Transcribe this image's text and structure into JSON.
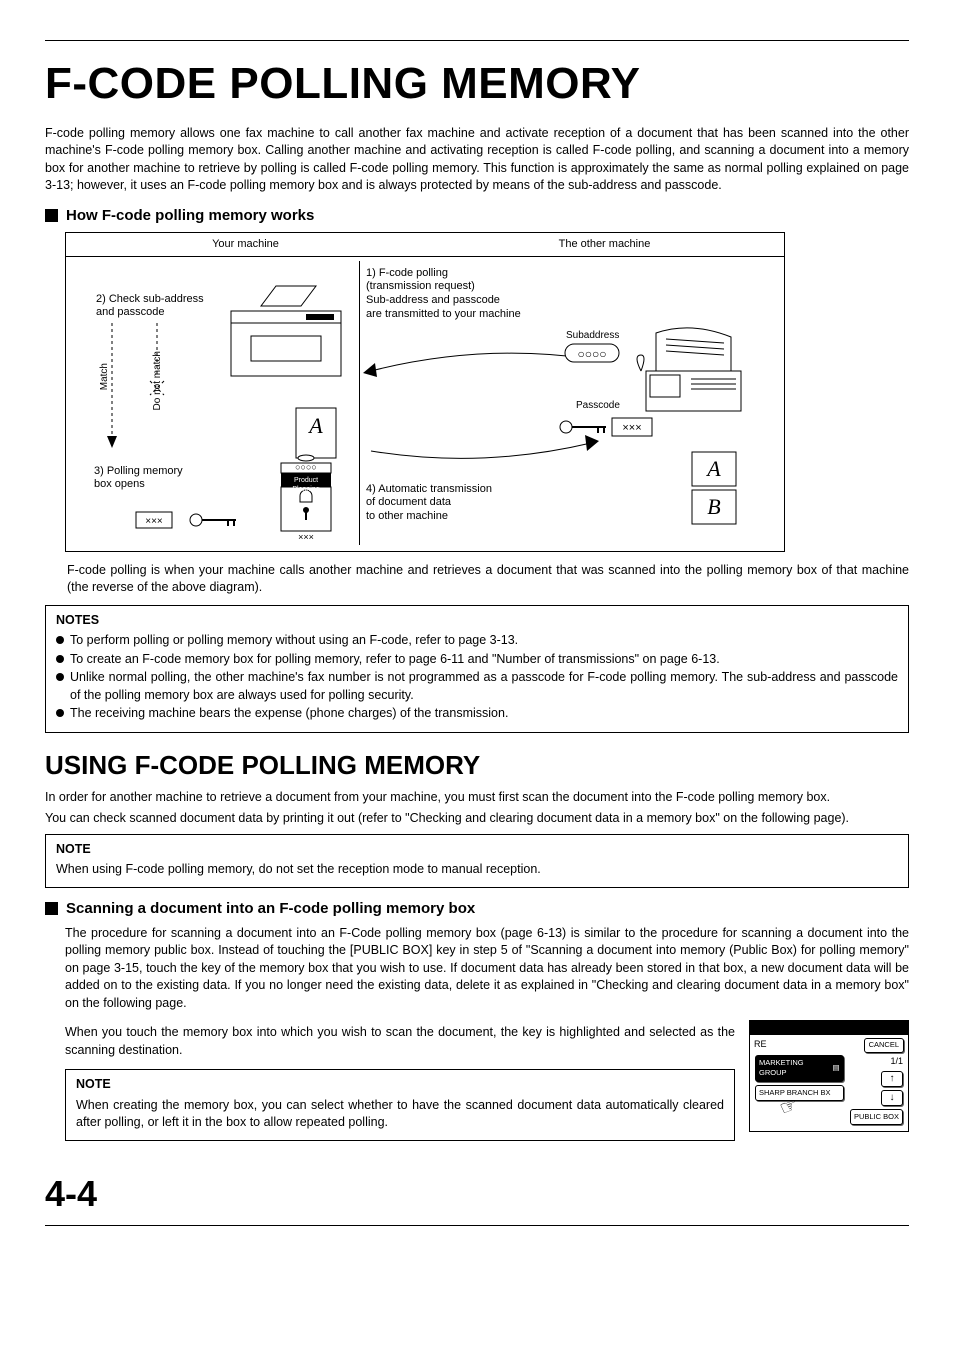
{
  "page": {
    "title": "F-CODE POLLING MEMORY",
    "intro": "F-code polling memory allows one fax machine to call another fax machine and activate reception of a document that has been scanned into the other machine's F-code polling memory box. Calling another machine and activating reception is called F-code polling, and scanning a document into a memory box for another machine to retrieve by polling is called F-code polling memory. This function is approximately the same as normal polling explained on page 3-13; however, it uses an F-code polling memory box and is always protected by means of the sub-address and passcode.",
    "sub1": "How F-code polling memory works",
    "diagram": {
      "your_machine": "Your machine",
      "other_machine": "The other machine",
      "step1a": "1) F-code polling",
      "step1b": "(transmission request)",
      "step1c": "Sub-address and passcode",
      "step1d": "are transmitted to your machine",
      "step2a": "2) Check sub-address",
      "step2b": "and passcode",
      "match": "Match",
      "no_match": "Do not match",
      "step3a": "3) Polling memory",
      "step3b": "box opens",
      "box_label": "Product Planning",
      "step4a": "4) Automatic transmission",
      "step4b": "of document data",
      "step4c": "to other machine",
      "subaddress": "Subaddress",
      "passcode": "Passcode"
    },
    "post_diagram": "F-code polling is when your machine calls another machine and retrieves a document that was scanned into the polling memory box of that machine (the reverse of the above diagram).",
    "notes1_title": "NOTES",
    "notes1": [
      "To perform polling or polling memory without using an F-code, refer to page 3-13.",
      "To create an F-code memory box for polling memory, refer to page 6-11 and \"Number of transmissions\" on page 6-13.",
      "Unlike normal polling, the other machine's fax number is not programmed as a passcode for F-code polling memory. The sub-address and passcode of the polling memory box are always used for polling security.",
      "The receiving machine bears the expense (phone charges) of the transmission."
    ],
    "section2_title": "USING F-CODE POLLING MEMORY",
    "section2_p1": "In order for another machine to retrieve a document from your machine, you must first scan the document into the F-code polling memory box.",
    "section2_p2": "You can check scanned document data by printing it out (refer to \"Checking and clearing document data in a memory box\" on the following page).",
    "note2_title": "NOTE",
    "note2_text": "When using F-code polling memory, do not set the reception mode to manual reception.",
    "sub2": "Scanning a document into an F-code polling memory box",
    "sub2_p1": "The procedure for scanning a document into an F-Code polling memory box (page 6-13) is similar to the procedure for scanning a document into the polling memory public box. Instead of touching the [PUBLIC BOX] key in step 5 of \"Scanning a document into memory (Public Box) for polling memory\" on page 3-15, touch the key of the memory box that you wish to use. If document data has already been stored in that box, a new document data will be added on to the existing data. If you no longer need the existing data, delete it as explained in \"Checking and clearing document data in a memory box\" on the following page.",
    "sub2_p2": "When you touch the memory box into which you wish to scan the document, the key is highlighted and selected as the scanning destination.",
    "note3_title": "NOTE",
    "note3_text": "When creating the memory box, you can select whether to have the scanned document data automatically cleared after polling, or left it in the box to allow repeated polling.",
    "panel": {
      "re": "RE",
      "cancel": "CANCEL",
      "item1": "MARKETING GROUP",
      "item2": "SHARP BRANCH BX",
      "pager": "1/1",
      "public": "PUBLIC BOX"
    },
    "page_number": "4-4"
  }
}
